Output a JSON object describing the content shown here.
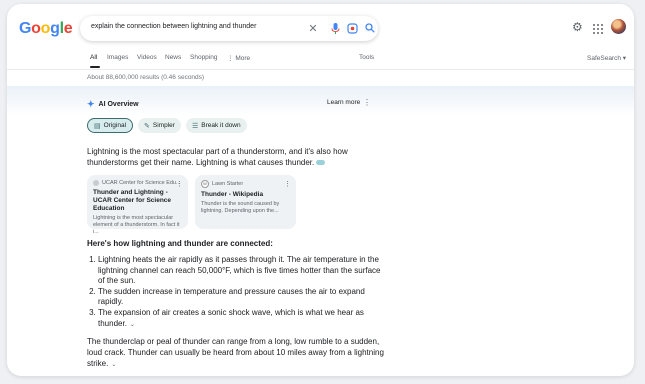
{
  "logo": "Google",
  "search": {
    "query": "explain the connection between lightning and thunder"
  },
  "tabs": [
    "All",
    "Images",
    "Videos",
    "News",
    "Shopping",
    "More"
  ],
  "tools_label": "Tools",
  "safesearch_label": "SafeSearch",
  "results_info": "About 88,600,000 results (0.46 seconds)",
  "ai_overview": {
    "title": "AI Overview",
    "learn_more": "Learn more",
    "chips": [
      "Original",
      "Simpler",
      "Break it down"
    ],
    "intro": "Lightning is the most spectacular part of a thunderstorm, and it's also how thunderstorms get their name. Lightning is what causes thunder.",
    "sources": [
      {
        "site": "UCAR Center for Science Edu...",
        "title": "Thunder and Lightning - UCAR Center for Science Education",
        "snippet": "Lightning is the most spectacular element of a thunderstorm. In fact it i..."
      },
      {
        "site": "Lawn Starter",
        "title": "Thunder - Wikipedia",
        "snippet": "Thunder is the sound caused by lightning. Depending upon the..."
      }
    ],
    "heading": "Here's how lightning and thunder are connected:",
    "steps": [
      "Lightning heats the air rapidly as it passes through it. The air temperature in the lightning channel can reach 50,000°F, which is five times hotter than the surface of the sun.",
      "The sudden increase in temperature and pressure causes the air to expand rapidly.",
      "The expansion of air creates a sonic shock wave, which is what we hear as thunder."
    ],
    "outro": "The thunderclap or peal of thunder can range from a long, low rumble to a sudden, loud crack. Thunder can usually be heard from about 10 miles away from a lightning strike."
  },
  "colors": {
    "accent": "#1a73e8",
    "chip_selected": "#3c6b6f"
  }
}
